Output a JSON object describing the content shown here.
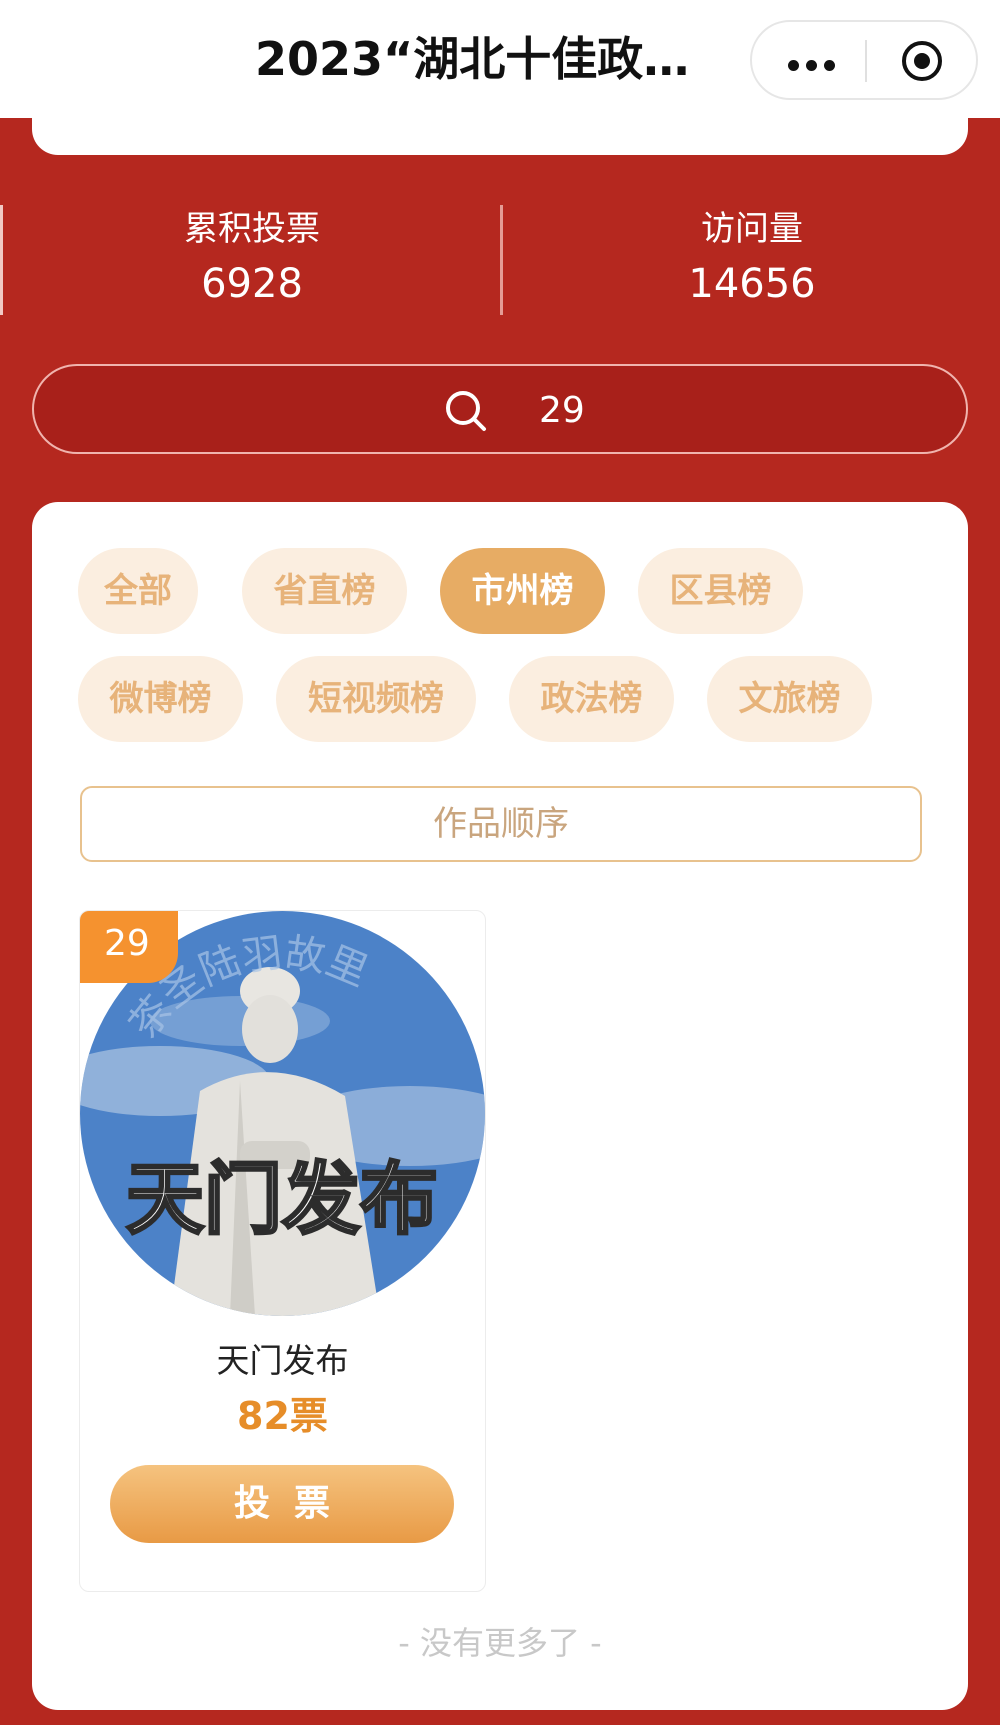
{
  "nav": {
    "title": "2023“湖北十佳政…"
  },
  "stats": {
    "total_votes_label": "累积投票",
    "total_votes_value": "6928",
    "visits_label": "访问量",
    "visits_value": "14656"
  },
  "search": {
    "query": "29"
  },
  "categories": [
    {
      "label": "全部",
      "active": false
    },
    {
      "label": "省直榜",
      "active": false
    },
    {
      "label": "市州榜",
      "active": true
    },
    {
      "label": "区县榜",
      "active": false
    },
    {
      "label": "微博榜",
      "active": false
    },
    {
      "label": "短视频榜",
      "active": false
    },
    {
      "label": "政法榜",
      "active": false
    },
    {
      "label": "文旅榜",
      "active": false
    }
  ],
  "sort": {
    "label": "作品顺序"
  },
  "items": [
    {
      "rank": "29",
      "name": "天门发布",
      "votes": "82票",
      "vote_button": "投票",
      "avatar_text": "天门发布",
      "avatar_arc_text": "茶圣陆羽故里"
    }
  ],
  "footer": {
    "no_more": "- 没有更多了 -"
  },
  "colors": {
    "background": "#b5281f",
    "accent": "#e7ac64",
    "votes": "#e68d29",
    "rank_badge": "#f5922f"
  }
}
